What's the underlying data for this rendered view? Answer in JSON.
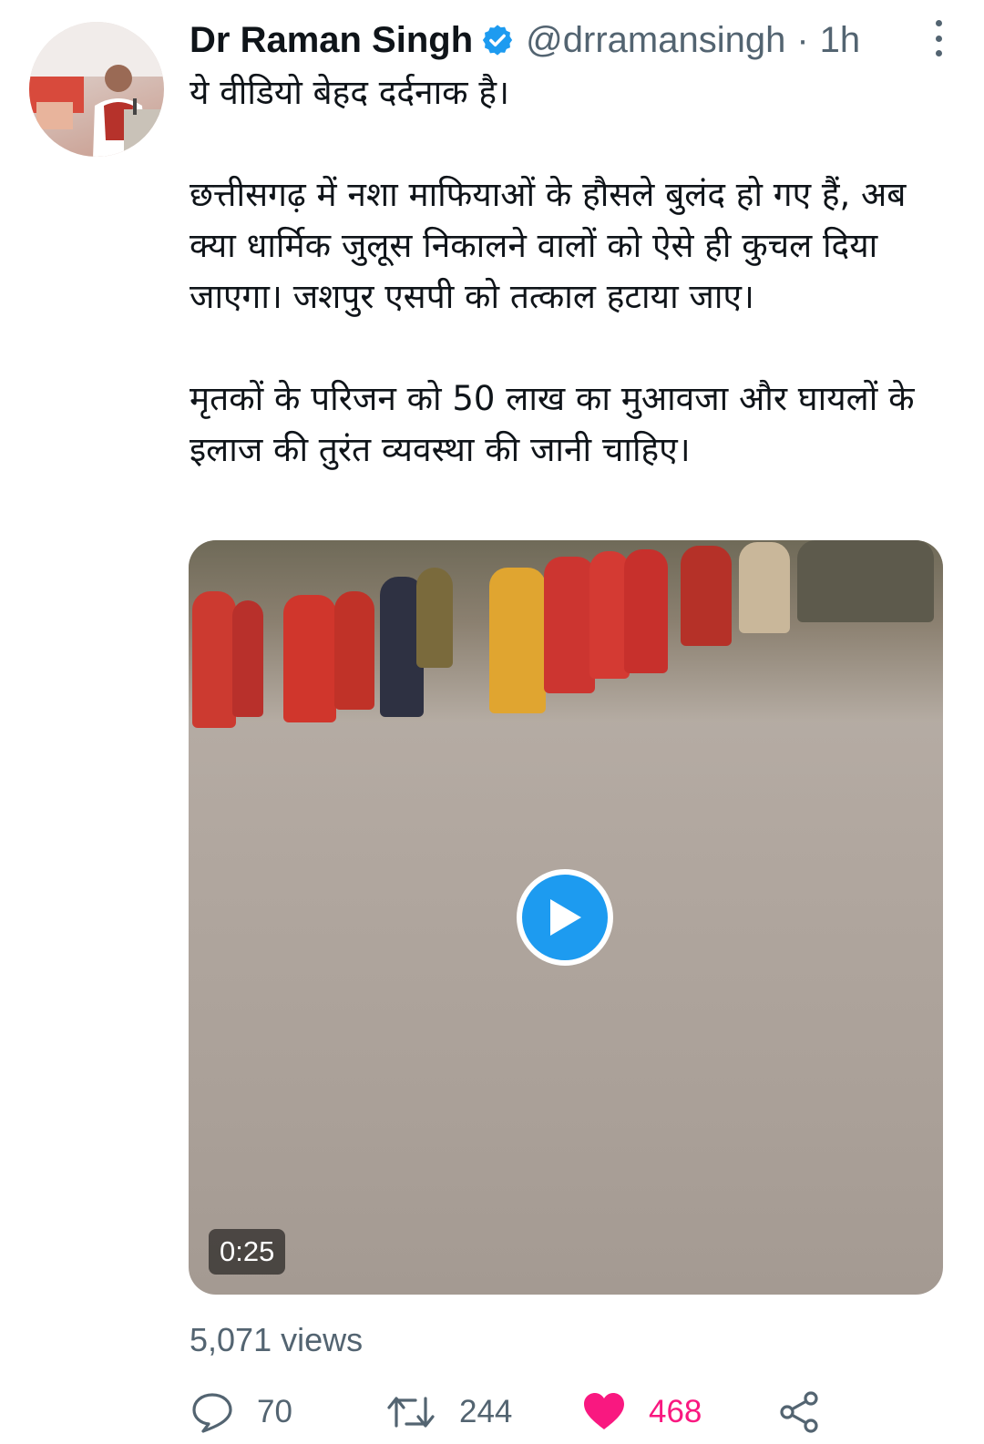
{
  "tweet": {
    "author_name": "Dr Raman Singh",
    "handle": "@drramansingh",
    "separator": "·",
    "time": "1h",
    "text": [
      "ये वीडियो बेहद दर्दनाक है।",
      "छत्तीसगढ़ में नशा माफियाओं के हौसले बुलंद हो गए हैं, अब क्या धार्मिक जुलूस निकालने वालों को ऐसे ही कुचल दिया जाएगा। जशपुर एसपी को तत्काल हटाया जाए।",
      "मृतकों के परिजन को 50 लाख का मुआवजा और घायलों के इलाज की तुरंत व्यवस्था की जानी चाहिए।"
    ],
    "video": {
      "duration": "0:25"
    },
    "views": "5,071 views",
    "replies": "70",
    "retweets": "244",
    "likes": "468"
  },
  "icons": {
    "verified": "verified-badge-icon",
    "more": "more-vertical-icon",
    "play": "play-icon",
    "reply": "reply-icon",
    "retweet": "retweet-icon",
    "like": "heart-icon",
    "share": "share-icon"
  },
  "colors": {
    "accent": "#1d9bf0",
    "like": "#f91880",
    "secondary_text": "#536471",
    "primary_text": "#0f1419"
  }
}
